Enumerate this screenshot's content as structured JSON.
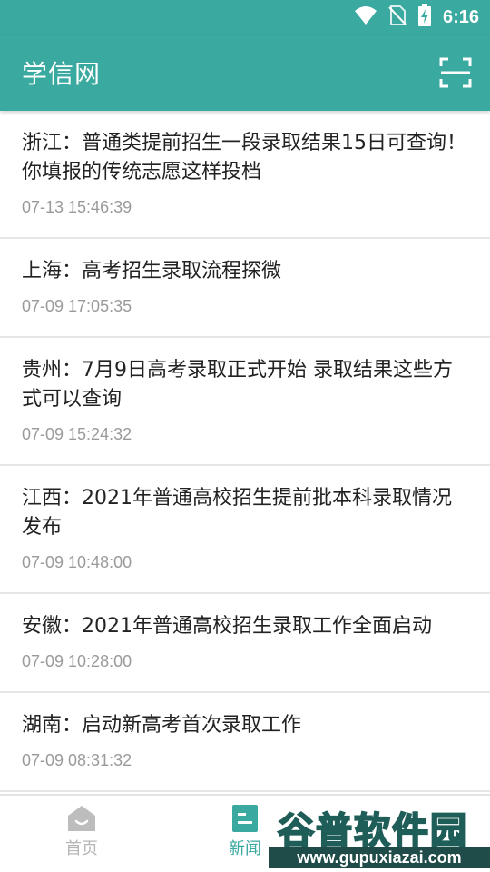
{
  "status_bar": {
    "time": "6:16",
    "icons": [
      "wifi-icon",
      "no-sim-icon",
      "battery-charging-icon"
    ]
  },
  "app_bar": {
    "title": "学信网",
    "scan_icon": "scan-icon"
  },
  "news": [
    {
      "title": "浙江：普通类提前招生一段录取结果15日可查询！你填报的传统志愿这样投档",
      "time": "07-13 15:46:39"
    },
    {
      "title": "上海：高考招生录取流程探微",
      "time": "07-09 17:05:35"
    },
    {
      "title": "贵州：7月9日高考录取正式开始 录取结果这些方式可以查询",
      "time": "07-09 15:24:32"
    },
    {
      "title": "江西：2021年普通高校招生提前批本科录取情况发布",
      "time": "07-09 10:48:00"
    },
    {
      "title": "安徽：2021年普通高校招生录取工作全面启动",
      "time": "07-09 10:28:00"
    },
    {
      "title": "湖南：启动新高考首次录取工作",
      "time": "07-09 08:31:32"
    }
  ],
  "bottom_nav": {
    "tabs": [
      {
        "label": "首页",
        "icon": "home-icon",
        "active": false
      },
      {
        "label": "新闻",
        "icon": "news-icon",
        "active": true
      }
    ]
  },
  "watermark": {
    "title": "谷普软件园",
    "url": "www.gupuxiazai.com"
  },
  "colors": {
    "primary": "#3aa99f",
    "text": "#222222",
    "timestamp": "#9a9a9a",
    "inactive_tab": "#b6b6b6"
  }
}
